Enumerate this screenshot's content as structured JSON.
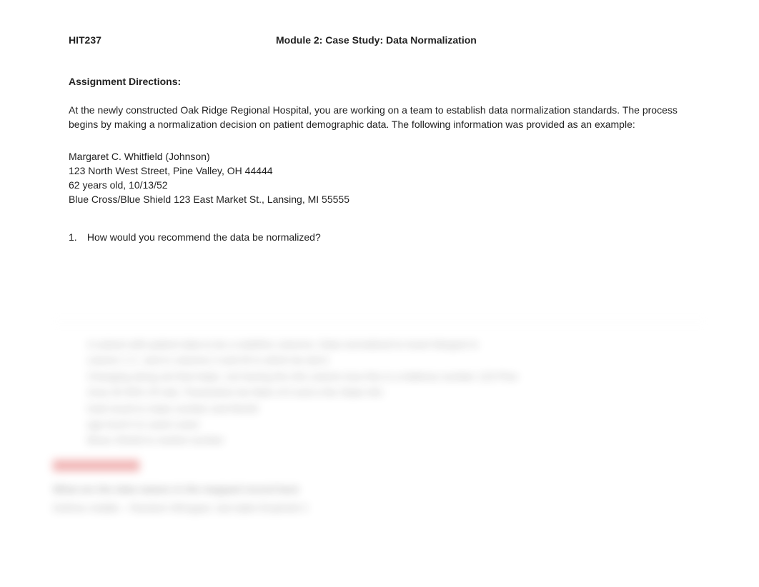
{
  "header": {
    "course_code": "HIT237",
    "module_title": "Module 2:  Case Study:  Data Normalization"
  },
  "directions_heading": "Assignment Directions:",
  "intro_paragraph": "At the newly constructed Oak Ridge Regional Hospital, you are working on a team to establish data normalization standards. The process begins by making a normalization decision on patient demographic data. The following information was provided as an example:",
  "patient": {
    "name": " Margaret C. Whitfield (Johnson)",
    "address": "123 North West Street, Pine Valley, OH 44444",
    "age_dob": "62 years old, 10/13/52",
    "insurance": "Blue Cross/Blue Shield 123 East Market St., Lansing, MI 55555"
  },
  "question1": {
    "number": "1.",
    "text": "How would you recommend the data be normalized?"
  },
  "blurred": {
    "b1": "A subset with patient data to be a redefine columns. Data normalized to insert Margret in",
    "b2": "column 1 C. and in columns 3 and W in which be don't.",
    "b3": "Changing along set that helps. not having the info column lose this is a Address number 123 Pine",
    "b4": "Area 34 95% Of rate. Parameters be Main of it and a the State info",
    "b5": "hold result to make number and Month",
    "b6": "age level it is used Lower",
    "b7": "Blues Shield to market number",
    "red": "redacted text area",
    "h1": "What are the data names in the mapped record best",
    "h2": "Defines middle – Random Whopper, last table Empheld C"
  }
}
